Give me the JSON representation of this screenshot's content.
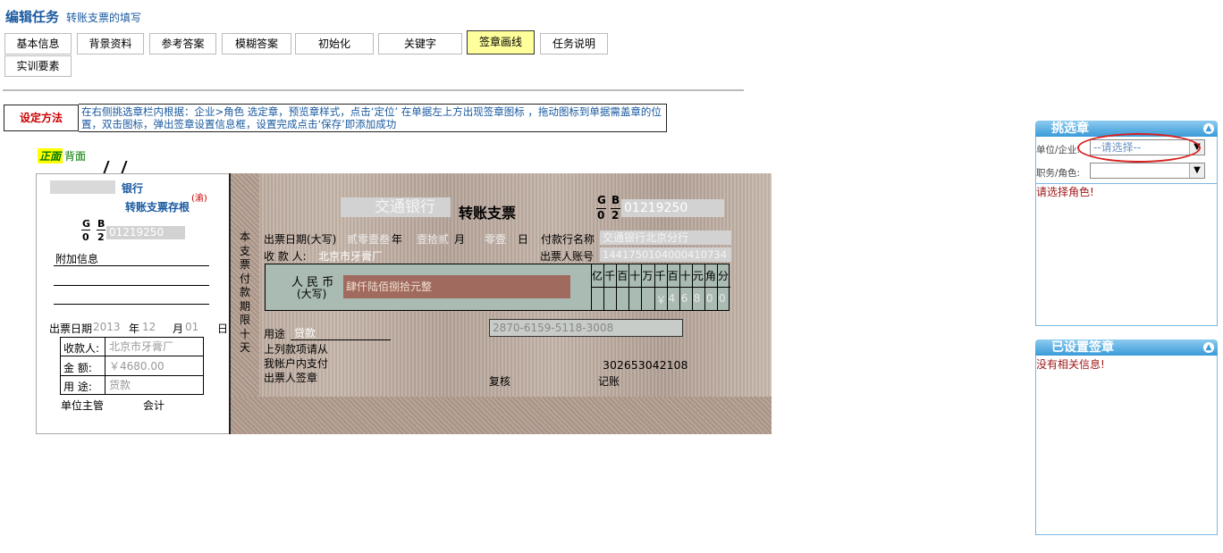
{
  "header": {
    "title": "编辑任务",
    "subtitle": "转账支票的填写"
  },
  "tabs": [
    {
      "label": "基本信息"
    },
    {
      "label": "背景资料"
    },
    {
      "label": "参考答案"
    },
    {
      "label": "模糊答案"
    },
    {
      "label": "初始化"
    },
    {
      "label": "关键字"
    },
    {
      "label": "签章画线",
      "active": true
    },
    {
      "label": "任务说明"
    },
    {
      "label": "实训要素"
    }
  ],
  "method": {
    "button_label": "设定方法",
    "instruction": "在右侧挑选章栏内根据：企业>角色 选定章，预览章样式，点击‘定位’ 在单据左上方出现签章图标 ，拖动图标到单据需盖章的位置，双击图标，弹出签章设置信息框，设置完成点击‘保存’即添加成功"
  },
  "sides": {
    "front": "正面",
    "back": "背面"
  },
  "stub": {
    "bank": "银行",
    "mark": "(渝)",
    "title": "转账支票存根",
    "g": "G",
    "b": "B",
    "g2": "0",
    "b2": "2",
    "number": "01219250",
    "extra_info": "附加信息",
    "date_label": "出票日期",
    "year": "2013",
    "year_unit": "年",
    "month": "12",
    "month_unit": "月",
    "day": "01",
    "day_unit": "日",
    "payee_label": "收款人:",
    "payee": "北京市牙膏厂",
    "amount_label": "金  额:",
    "amount": "￥4680.00",
    "purpose_label": "用  途:",
    "purpose": "货款",
    "supervisor": "单位主管",
    "accountant": "会计"
  },
  "check": {
    "bank_name": "交通银行",
    "title": "转账支票",
    "g": "G",
    "b": "B",
    "g2": "0",
    "b2": "2",
    "number": "01219250",
    "vertical_text": "本支票付款期限十天",
    "date_label": "出票日期(大写)",
    "date_year": "贰零壹叁",
    "year_unit": "年",
    "date_month": "壹拾贰",
    "month_unit": "月",
    "date_day": "零壹",
    "day_unit": "日",
    "payer_bank_label": "付款行名称",
    "payer_bank": "交通银行北京分行",
    "payee_label": "收 款 人:",
    "payee": "北京市牙膏厂",
    "account_label": "出票人账号",
    "account": "1441750104000410734",
    "rmb_label": "人 民 币",
    "rmb_sub": "(大写)",
    "amount_words": "肆仟陆佰捌拾元整",
    "digit_headers": [
      "亿",
      "千",
      "百",
      "十",
      "万",
      "千",
      "百",
      "十",
      "元",
      "角",
      "分"
    ],
    "digits": [
      "",
      "",
      "",
      "",
      "",
      "￥",
      "4",
      "6",
      "8",
      "0",
      "0"
    ],
    "purpose_label": "用途",
    "purpose": "贷款",
    "password": "2870-6159-5118-3008",
    "lines": [
      "上列款项请从",
      "我帐户内支付",
      "出票人签章"
    ],
    "serial": "302653042108",
    "review": "复核",
    "bookkeeping": "记账"
  },
  "panel": {
    "pick_title": "挑选章",
    "unit_label": "单位/企业:",
    "unit_placeholder": "--请选择--",
    "role_label": "职务/角色:",
    "role_msg": "请选择角色!",
    "set_title": "已设置签章",
    "set_msg": "没有相关信息!"
  }
}
